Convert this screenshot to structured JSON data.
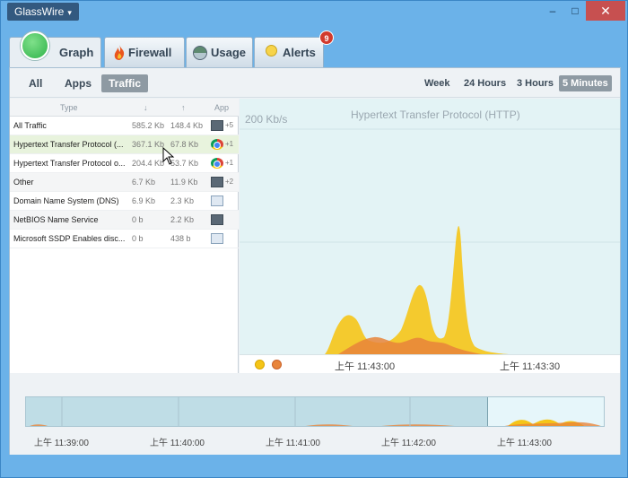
{
  "app": {
    "title": "GlassWire",
    "menu_caret": "▾"
  },
  "window_controls": {
    "minimize": "–",
    "maximize": "□",
    "close": "✕"
  },
  "tabs": [
    {
      "label": "Graph",
      "icon": "green-circle-icon",
      "active": true
    },
    {
      "label": "Firewall",
      "icon": "fire-icon"
    },
    {
      "label": "Usage",
      "icon": "usage-globe-icon"
    },
    {
      "label": "Alerts",
      "icon": "lightbulb-icon",
      "badge": "9"
    }
  ],
  "filters": {
    "all": "All",
    "apps": "Apps",
    "traffic": "Traffic",
    "active": "Traffic"
  },
  "ranges": {
    "week": "Week",
    "h24": "24 Hours",
    "h3": "3 Hours",
    "m5": "5 Minutes",
    "active": "5 Minutes"
  },
  "table": {
    "headers": {
      "type": "Type",
      "down": "↓",
      "up": "↑",
      "app": "App"
    },
    "rows": [
      {
        "name": "All Traffic",
        "down": "585.2 Kb",
        "up": "148.4 Kb",
        "app_icon": "network-icon",
        "count": "+5"
      },
      {
        "name": "Hypertext Transfer Protocol (...",
        "down": "367.1 Kb",
        "up": "67.8 Kb",
        "app_icon": "chrome-icon",
        "count": "+1",
        "selected": true
      },
      {
        "name": "Hypertext Transfer Protocol o...",
        "down": "204.4 Kb",
        "up": "53.7 Kb",
        "app_icon": "chrome-icon",
        "count": "+1"
      },
      {
        "name": "Other",
        "down": "6.7 Kb",
        "up": "11.9 Kb",
        "app_icon": "network-icon",
        "count": "+2"
      },
      {
        "name": "Domain Name System (DNS)",
        "down": "6.9 Kb",
        "up": "2.3 Kb",
        "app_icon": "window-icon",
        "count": ""
      },
      {
        "name": "NetBIOS Name Service",
        "down": "0 b",
        "up": "2.2 Kb",
        "app_icon": "network-icon",
        "count": ""
      },
      {
        "name": "Microsoft SSDP Enables disc...",
        "down": "0 b",
        "up": "438 b",
        "app_icon": "window-icon",
        "count": ""
      }
    ]
  },
  "chart": {
    "scale": "200 Kb/s",
    "title": "Hypertext Transfer Protocol (HTTP)",
    "time_labels": [
      "上午 11:43:00",
      "上午 11:43:30"
    ],
    "colors": {
      "incoming": "#f5c518",
      "outgoing": "#e8843a"
    }
  },
  "timeline": {
    "labels": [
      "上午 11:39:00",
      "上午 11:40:00",
      "上午 11:41:00",
      "上午 11:42:00",
      "上午 11:43:00"
    ]
  }
}
